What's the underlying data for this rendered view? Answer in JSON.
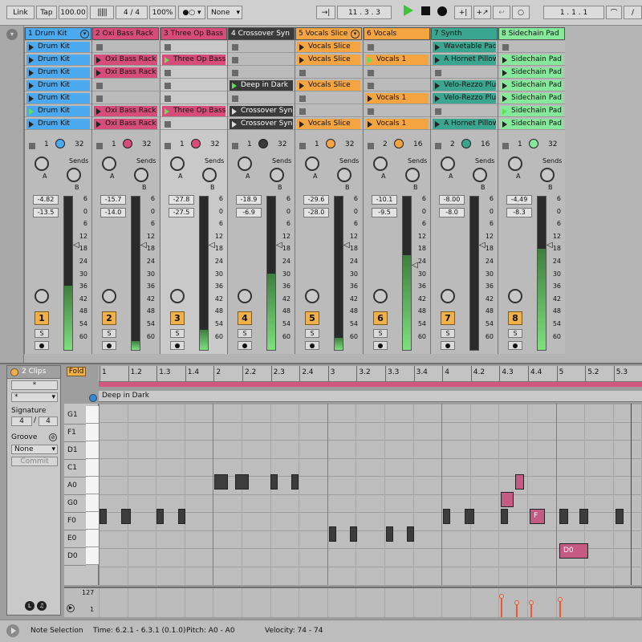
{
  "topbar": {
    "link": "Link",
    "tap": "Tap",
    "tempo": "100.00",
    "signature": "4 / 4",
    "zoom": "100%",
    "metro_mode": "None",
    "position": "11 . 3 . 3",
    "loop_pos": "1 . 1 . 1"
  },
  "tracks": [
    {
      "name": "1 Drum Kit",
      "color": "#4ba9f0",
      "hdr": "#4ba9f0",
      "clip_color": "#4ba9f0",
      "clips": [
        "Drum Kit",
        "Drum Kit",
        "Drum Kit",
        "Drum Kit",
        "Drum Kit",
        "Drum Kit",
        "Drum Kit"
      ],
      "playing": [
        false,
        false,
        false,
        false,
        false,
        true,
        false
      ],
      "ch": "1",
      "out": "32",
      "vol": "-4.82",
      "peak": "-13.5",
      "num": "1",
      "fill": 0.42
    },
    {
      "name": "2 Oxi Bass Rack",
      "color": "#d84c7a",
      "hdr": "#d84c7a",
      "clip_color": "#d84c7a",
      "clips": [
        "",
        "Oxi Bass Rack",
        "Oxi Bass Rack",
        "",
        "",
        "Oxi Bass Rack",
        "Oxi Bass Rack"
      ],
      "playing": [
        false,
        false,
        false,
        false,
        false,
        false,
        false
      ],
      "ch": "1",
      "out": "32",
      "vol": "-15.7",
      "peak": "-14.0",
      "num": "2",
      "fill": 0.06
    },
    {
      "name": "3 Three Op Bass",
      "color": "#d84c7a",
      "hdr": "#d84c7a",
      "clip_color": "#d84c7a",
      "clips": [
        "",
        "Three Op Bass",
        "",
        "",
        "",
        "Three Op Bass",
        ""
      ],
      "playing": [
        false,
        true,
        false,
        false,
        false,
        true,
        false
      ],
      "ch": "1",
      "out": "32",
      "vol": "-27.8",
      "peak": "-27.5",
      "num": "3",
      "fill": 0.13
    },
    {
      "name": "4 Crossover Syn",
      "color": "#3a3a3a",
      "hdr": "#3a3a3a",
      "clip_color": "#3a3a3a",
      "clips": [
        "",
        "",
        "",
        "Deep in Dark",
        "",
        "Crossover Syn B",
        "Crossover Syn B"
      ],
      "playing": [
        false,
        false,
        false,
        true,
        false,
        false,
        false
      ],
      "ch": "1",
      "out": "32",
      "vol": "-18.9",
      "peak": "-6.9",
      "num": "4",
      "fill": 0.5
    },
    {
      "name": "5 Vocals Slice",
      "color": "#f5a442",
      "hdr": "#f5a442",
      "clip_color": "#f5a442",
      "clips": [
        "Vocals Slice",
        "Vocals Slice",
        "",
        "Vocals Slice",
        "",
        "",
        "Vocals Slice"
      ],
      "playing": [
        false,
        false,
        false,
        false,
        false,
        false,
        false
      ],
      "ch": "1",
      "out": "32",
      "vol": "-29.6",
      "peak": "-28.0",
      "num": "5",
      "fill": 0.08
    },
    {
      "name": "6 Vocals",
      "color": "#f5a442",
      "hdr": "#f5a442",
      "clip_color": "#f5a442",
      "clips": [
        "",
        "Vocals 1",
        "",
        "",
        "Vocals 1",
        "",
        "Vocals 1"
      ],
      "playing": [
        false,
        true,
        false,
        false,
        false,
        false,
        false
      ],
      "ch": "2",
      "out": "16",
      "vol": "-10.1",
      "peak": "-9.5",
      "num": "6",
      "fill": 0.62
    },
    {
      "name": "7 Synth",
      "color": "#3aa690",
      "hdr": "#3aa690",
      "clip_color": "#3aa690",
      "clips": [
        "Wavetable Pad",
        "A Hornet Pillow",
        "",
        "Velo-Rezzo Plug",
        "Velo-Rezzo Plug",
        "",
        "A Hornet Pillow"
      ],
      "playing": [
        false,
        false,
        false,
        false,
        false,
        false,
        false
      ],
      "ch": "2",
      "out": "16",
      "vol": "-8.00",
      "peak": "-8.0",
      "num": "7",
      "fill": 0.0
    },
    {
      "name": "8 Sidechain Pad",
      "color": "#86e89a",
      "hdr": "#86e89a",
      "clip_color": "#86e89a",
      "clips": [
        "",
        "Sidechain Pad",
        "Sidechain Pad",
        "Sidechain Pad",
        "Sidechain Pad",
        "Sidechain Pad",
        "Sidechain Pad"
      ],
      "playing": [
        false,
        false,
        false,
        false,
        false,
        true,
        false
      ],
      "ch": "1",
      "out": "32",
      "vol": "-4.49",
      "peak": "-8.3",
      "num": "8",
      "fill": 0.66
    }
  ],
  "mixer": {
    "sends_label": "Sends",
    "send_a": "A",
    "send_b": "B",
    "solo": "S",
    "db_scale": [
      "6",
      "0",
      "6",
      "12",
      "18",
      "24",
      "30",
      "36",
      "42",
      "48",
      "54",
      "60"
    ]
  },
  "clip_panel": {
    "title": "2 Clips",
    "field1": "*",
    "field2": "*",
    "signature_label": "Signature",
    "sig_num": "4",
    "sig_den": "4",
    "groove_label": "Groove",
    "groove_value": "None",
    "commit": "Commit"
  },
  "piano": {
    "fold": "Fold",
    "clip_name": "Deep in Dark",
    "keys": [
      "G1",
      "F1",
      "D1",
      "C1",
      "A0",
      "G0",
      "F0",
      "E0",
      "D0"
    ],
    "ruler": [
      "1",
      "1.2",
      "1.3",
      "1.4",
      "2",
      "2.2",
      "2.3",
      "2.4",
      "3",
      "3.2",
      "3.3",
      "3.4",
      "4",
      "4.2",
      "4.3",
      "4.4",
      "5",
      "5.2",
      "5.3"
    ],
    "vel_top": "127",
    "vel_bottom": "1",
    "note_f": "F",
    "note_d0": "D0"
  },
  "status": {
    "mode": "Note Selection",
    "time": "Time: 6.2.1 - 6.3.1 (0.1.0)",
    "pitch": "Pitch: A0 - A0",
    "velocity": "Velocity: 74 - 74"
  }
}
